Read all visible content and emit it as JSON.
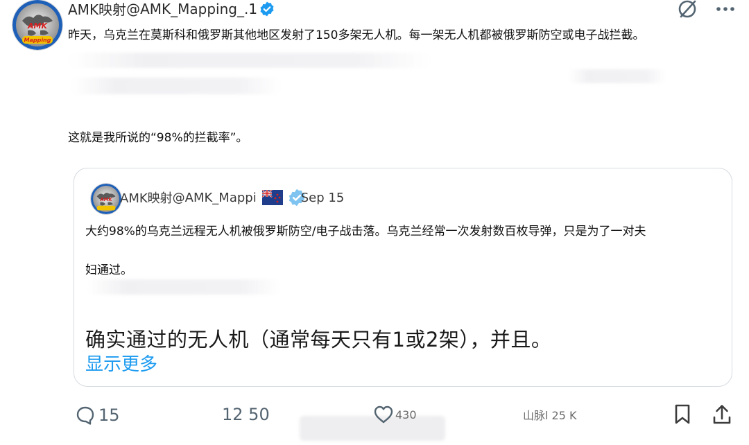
{
  "post": {
    "display_name": "AMK映射",
    "handle": "@AMK_Mapping_.",
    "handle_fragment": "1",
    "text_line_1": "昨天，乌克兰在莫斯科和俄罗斯其他地区发射了150多架无人机。每一架无人机都被俄罗斯防空或电子战拦截。",
    "text_line_2": "这就是我所说的“98%的拦截率”。"
  },
  "quote": {
    "display_name": "AMK映射",
    "handle": "@AMK_Mappi",
    "date": "Sep 15",
    "text_line_1": "大约98%的乌克兰远程无人机被俄罗斯防空/电子战击落。乌克兰经常一次发射数百枚导弹，只是为了一对夫",
    "text_line_2": "妇通过。",
    "big_text": "确实通过的无人机（通常每天只有1或2架），并且。",
    "show_more": "显示更多"
  },
  "actions": {
    "reply_count": "15",
    "retweet_count": "12 50",
    "like_count": "430",
    "views_label": "山脉l 25 K"
  },
  "icons": {
    "grok": "grok-icon",
    "more": "more-icon",
    "verified": "verified-badge-icon",
    "reply": "reply-icon",
    "like": "heart-icon",
    "bookmark": "bookmark-icon",
    "share": "share-icon",
    "flag": "new-zealand-flag-icon"
  },
  "colors": {
    "accent": "#1d9bf0",
    "muted": "#536471",
    "border": "#d6dbe0"
  }
}
